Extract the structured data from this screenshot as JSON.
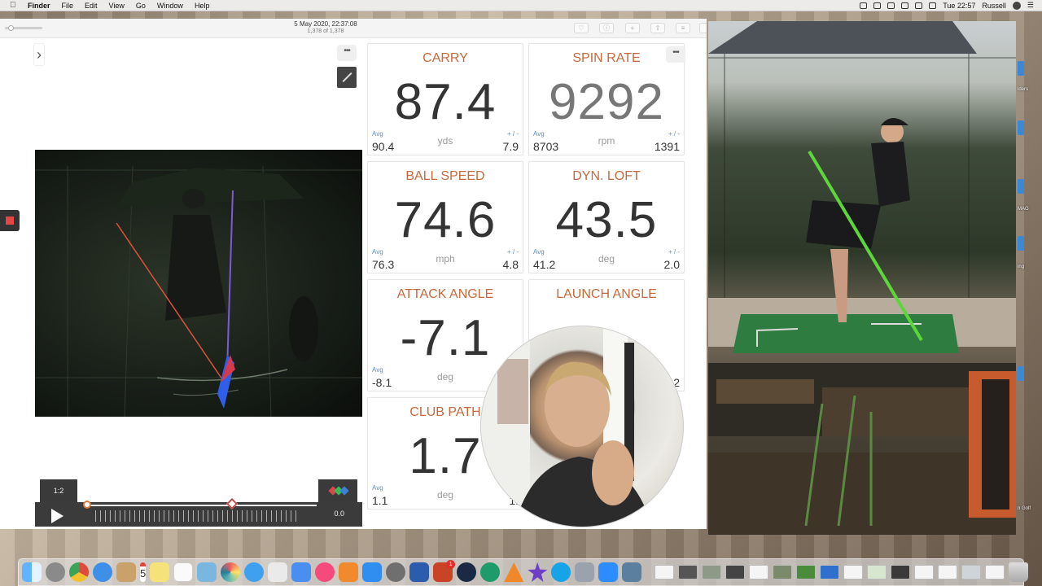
{
  "menubar": {
    "app_name": "Finder",
    "items": [
      "File",
      "Edit",
      "View",
      "Go",
      "Window",
      "Help"
    ],
    "clock": "Tue 22:57",
    "user": "Russell"
  },
  "window": {
    "date_title": "5 May 2020, 22:37:08",
    "shot_counter": "1,378 of 1,378"
  },
  "player": {
    "speed_label": "1:2",
    "time": "0.0"
  },
  "metrics": [
    {
      "title": "CARRY",
      "value": "87.4",
      "unit": "yds",
      "avg_label": "Avg",
      "avg": "90.4",
      "pm_label": "+ / -",
      "pm": "7.9"
    },
    {
      "title": "SPIN RATE",
      "value": "9292",
      "unit": "rpm",
      "avg_label": "Avg",
      "avg": "8703",
      "pm_label": "+ / -",
      "pm": "1391"
    },
    {
      "title": "BALL SPEED",
      "value": "74.6",
      "unit": "mph",
      "avg_label": "Avg",
      "avg": "76.3",
      "pm_label": "+ / -",
      "pm": "4.8"
    },
    {
      "title": "DYN. LOFT",
      "value": "43.5",
      "unit": "deg",
      "avg_label": "Avg",
      "avg": "41.2",
      "pm_label": "+ / -",
      "pm": "2.0"
    },
    {
      "title": "ATTACK ANGLE",
      "value": "-7.1",
      "unit": "deg",
      "avg_label": "Avg",
      "avg": "-8.1",
      "pm_label": "",
      "pm": ""
    },
    {
      "title": "LAUNCH ANGLE",
      "value": "",
      "unit": "",
      "avg_label": "",
      "avg": "",
      "pm_label": "",
      "pm": "2"
    },
    {
      "title": "CLUB PATH",
      "value": "1.7",
      "unit": "deg",
      "avg_label": "Avg",
      "avg": "1.1",
      "pm_label": "",
      "pm": "1."
    }
  ],
  "desktop_labels": [
    "lders",
    "MAG",
    "ing",
    "n Golf"
  ],
  "dock": {
    "calendar_day": "5",
    "office_badge": "1"
  },
  "colors": {
    "metric_title": "#c6693c",
    "value_text": "#343434",
    "avg_label": "#5f8ec3",
    "laser_line": "#5cd63a"
  }
}
